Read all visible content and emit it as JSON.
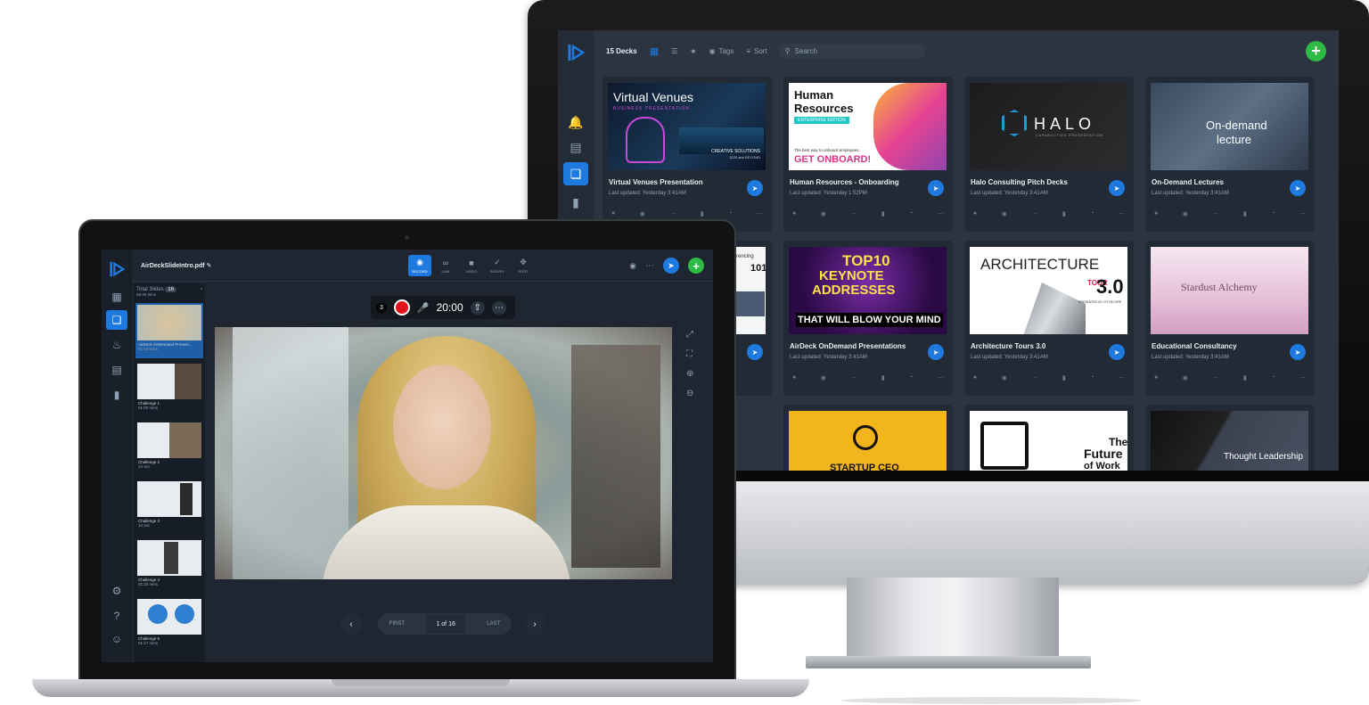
{
  "desktop": {
    "deck_count": "15 Decks",
    "toolbar": {
      "tags_label": "Tags",
      "sort_label": "Sort",
      "search_placeholder": "Search"
    },
    "cards": [
      {
        "title": "Virtual Venues Presentation",
        "date": "Last updated: Yesterday 3:41AM",
        "thumb_title": "Virtual Venues",
        "thumb_sub": "BUSINESS PRESENTATION",
        "thumb_note": "CREATIVE SOLUTIONS",
        "thumb_note2": "2020 and BEYOND"
      },
      {
        "title": "Human Resources - Onboarding",
        "date": "Last updated: Yesterday 1:52PM",
        "thumb_title1": "Human",
        "thumb_title2": "Resources",
        "thumb_badge": "ENTERPRISE EDITION",
        "thumb_note": "The best way to onboard employees.",
        "thumb_cta": "GET ONBOARD!"
      },
      {
        "title": "Halo Consulting Pitch Decks",
        "date": "Last updated: Yesterday 3:41AM",
        "thumb_title": "HALO",
        "thumb_sub": "CAPABILITIES PRESENTATION"
      },
      {
        "title": "On-Demand Lectures",
        "date": "Last updated: Yesterday 3:41AM",
        "thumb_title1": "On-demand",
        "thumb_title2": "lecture"
      },
      {
        "title": "",
        "date": "",
        "thumb_title": "Conferencing",
        "thumb_num": "101"
      },
      {
        "title": "AirDeck OnDemand Presentations",
        "date": "Last updated: Yesterday 3:41AM",
        "thumb_l1": "TOP10",
        "thumb_l2": "KEYNOTE",
        "thumb_l3": "ADDRESSES",
        "thumb_l4": "THAT WILL BLOW YOUR MIND"
      },
      {
        "title": "Architecture Tours 3.0",
        "date": "Last updated: Yesterday 3:41AM",
        "thumb_title": "ARCHITECTURE",
        "thumb_tour": "TOUR",
        "thumb_num": "3.0",
        "thumb_sub": "PRESENTED BY CITYSCOPE"
      },
      {
        "title": "Educational Consultancy",
        "date": "Last updated: Yesterday 3:41AM",
        "thumb_title": "Stardust Alchemy"
      },
      {
        "title": "",
        "date": "",
        "thumb_title": "STARTUP CEO"
      },
      {
        "title": "",
        "date": "",
        "thumb_title1": "The",
        "thumb_title2": "Future",
        "thumb_title3": "of Work"
      },
      {
        "title": "",
        "date": "",
        "thumb_title": "Thought Leadership"
      }
    ]
  },
  "laptop": {
    "file_name": "AirDeckSlideIntro.pdf",
    "tools": [
      "RECORD",
      "LINK",
      "VIDEO",
      "SURVEY",
      "SORT"
    ],
    "total_slides_label": "Total Slides",
    "total_slides_count": "16",
    "total_time": "08:40 mins",
    "countdown": "3",
    "timer": "20:00",
    "slides": [
      {
        "label": "AirDeck OnDemand Present...",
        "time": "01:14 mins"
      },
      {
        "label": "Challenge 1",
        "time": "01:00 mins"
      },
      {
        "label": "Challenge 2",
        "time": "14 sec"
      },
      {
        "label": "Challenge 3",
        "time": "10 sec"
      },
      {
        "label": "Challenge 4",
        "time": "01:20 mins"
      },
      {
        "label": "Challenge 5",
        "time": "01:17 mins"
      }
    ],
    "pager": {
      "first": "FIRST",
      "current": "1 of 16",
      "last": "LAST"
    }
  },
  "colors": {
    "accent": "#1f7ae0",
    "add": "#2dbb45",
    "record": "#e1141b",
    "bg_dark": "#2b3440"
  },
  "icons": [
    "logo-icon",
    "bell-icon",
    "chat-icon",
    "decks-icon",
    "chart-icon",
    "grid-icon",
    "list-icon",
    "star-icon",
    "tag-icon",
    "sort-icon",
    "search-icon",
    "plus-icon",
    "share-icon",
    "mic-icon",
    "link-icon",
    "video-icon",
    "survey-icon",
    "move-icon",
    "eye-icon",
    "more-icon",
    "upload-icon",
    "expand-icon",
    "fullscreen-icon",
    "zoom-in-icon",
    "zoom-out-icon",
    "gear-icon",
    "help-icon",
    "user-icon",
    "dashboard-icon",
    "chevron-left-icon",
    "chevron-right-icon"
  ]
}
